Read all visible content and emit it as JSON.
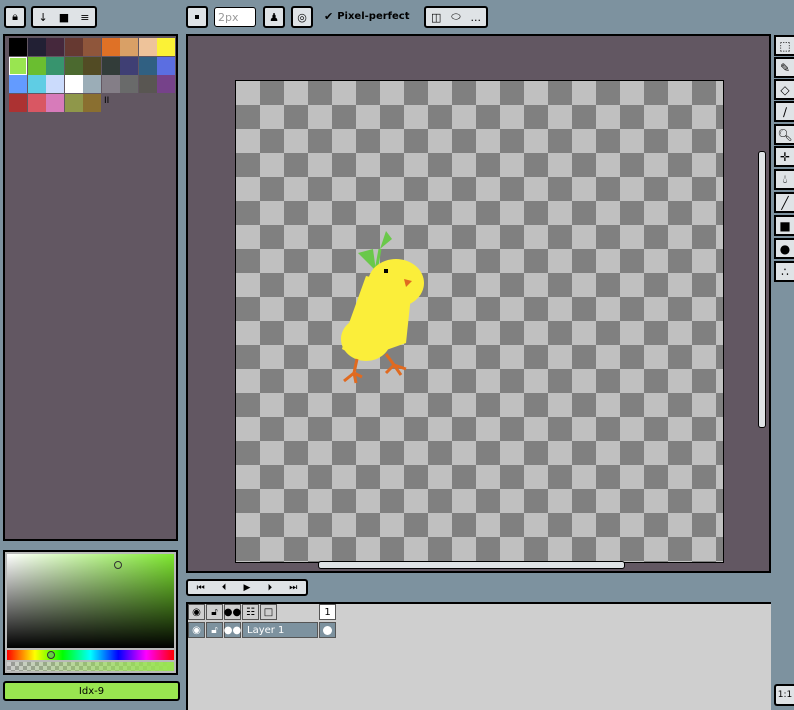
{
  "toolbar": {
    "brush_size": "2px",
    "pixel_perfect_label": "Pixel-perfect",
    "more_label": "..."
  },
  "palette": {
    "colors": [
      "#000000",
      "#222034",
      "#45283c",
      "#663931",
      "#8f563b",
      "#df7126",
      "#d9a066",
      "#eec39a",
      "#fbf236",
      "#99e550",
      "#6abe30",
      "#37946e",
      "#4b692f",
      "#524b24",
      "#323c39",
      "#3f3f74",
      "#306082",
      "#5b6ee1",
      "#639bff",
      "#5fcde4",
      "#cbdbfc",
      "#ffffff",
      "#9badb7",
      "#847e87",
      "#696a6a",
      "#595652",
      "#76428a",
      "#ac3232",
      "#d95763",
      "#d77bba",
      "#8f974a",
      "#8a6f30"
    ],
    "more_marker": "II"
  },
  "color_picker": {
    "index_label": "Idx-9",
    "current_color": "#99e550"
  },
  "timeline": {
    "frame_number": "1",
    "layer_name": "Layer 1"
  },
  "zoom_label": "1:1"
}
